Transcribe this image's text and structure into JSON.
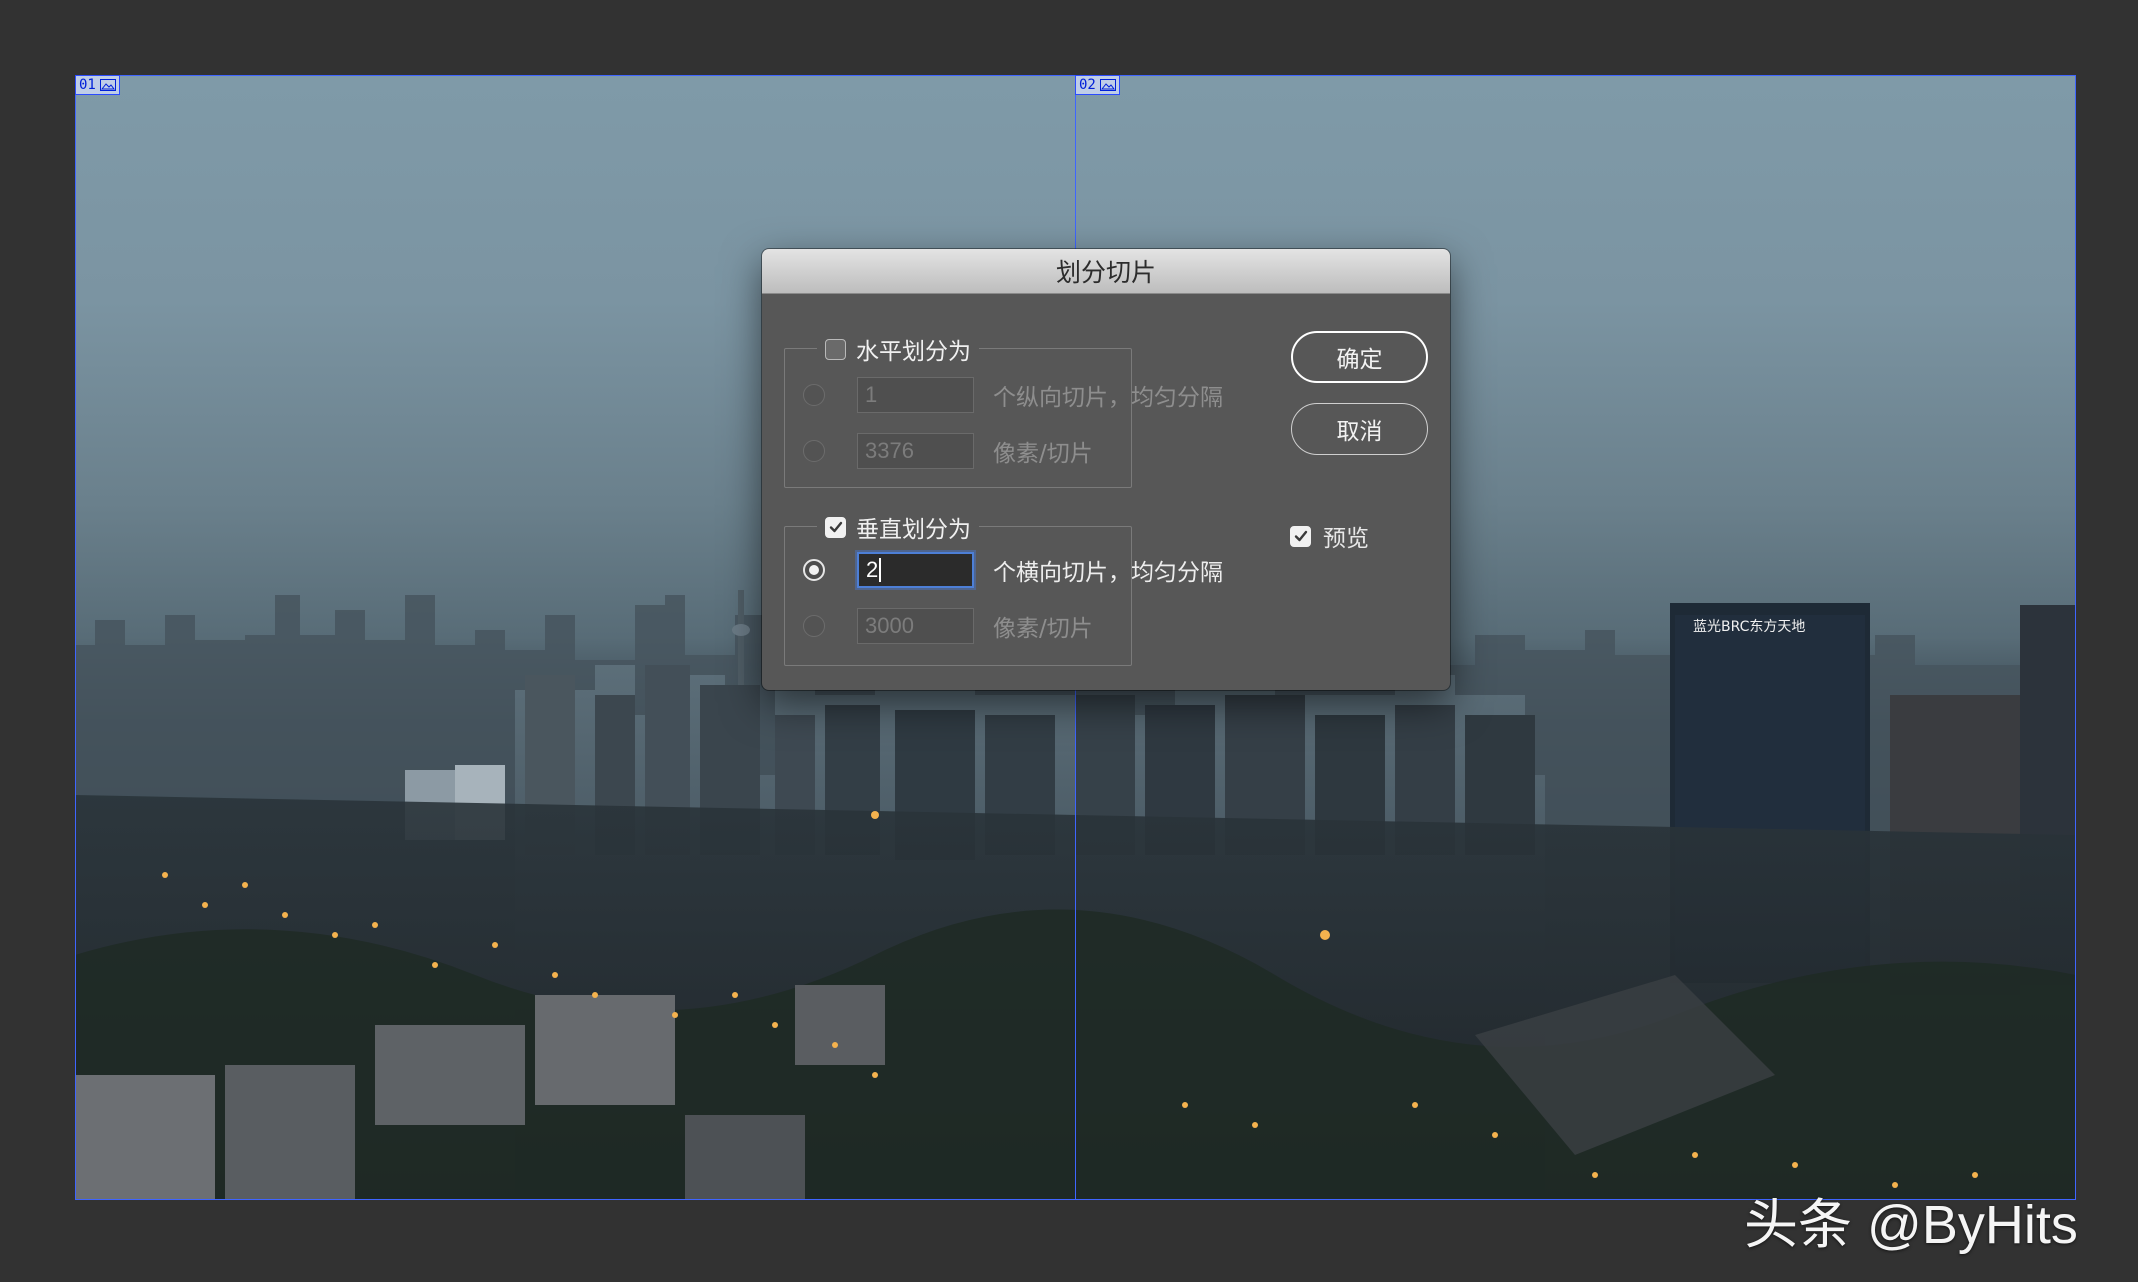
{
  "canvas": {
    "slices": [
      {
        "number": "01",
        "icon": "image-icon"
      },
      {
        "number": "02",
        "icon": "image-icon"
      }
    ],
    "building_sign": "蓝光BRC东方天地"
  },
  "dialog": {
    "title": "划分切片",
    "horizontal": {
      "label": "水平划分为",
      "checked": false,
      "count_value": "1",
      "count_label": "个纵向切片，均匀分隔",
      "pixels_value": "3376",
      "pixels_label": "像素/切片"
    },
    "vertical": {
      "label": "垂直划分为",
      "checked": true,
      "count_value": "2",
      "count_label": "个横向切片，均匀分隔",
      "pixels_value": "3000",
      "pixels_label": "像素/切片"
    },
    "ok_label": "确定",
    "cancel_label": "取消",
    "preview_label": "预览",
    "preview_checked": true
  },
  "watermark": "头条 @ByHits",
  "colors": {
    "slice_line": "#3f65ff",
    "dialog_bg": "#575757",
    "app_bg": "#323232",
    "focus_ring": "#4d7fd6"
  }
}
